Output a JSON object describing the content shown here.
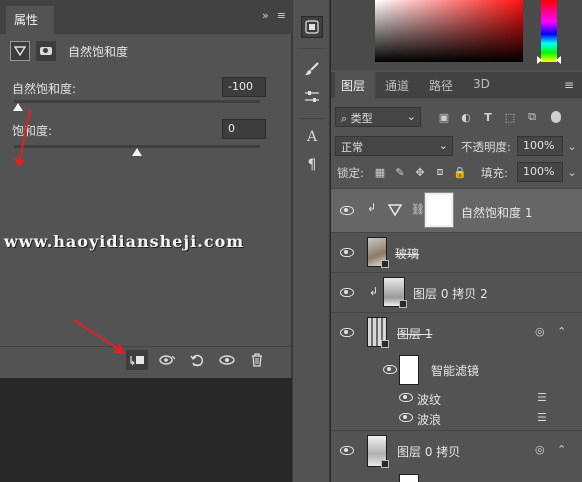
{
  "properties_panel": {
    "tab_label": "属性",
    "header_icons": [
      "»",
      "≡"
    ],
    "adjustment_title": "自然饱和度",
    "vibrance": {
      "label": "自然饱和度:",
      "value": "-100",
      "level": 0.0
    },
    "saturation": {
      "label": "饱和度:",
      "value": "0",
      "level": 0.5
    },
    "footer_buttons": [
      "clip-to-layer",
      "view-previous",
      "reset",
      "visibility",
      "delete"
    ]
  },
  "watermark": "www.haoyidiansheji.com",
  "layers_panel": {
    "tabs": [
      {
        "label": "图层",
        "active": true
      },
      {
        "label": "通道",
        "active": false
      },
      {
        "label": "路径",
        "active": false
      },
      {
        "label": "3D",
        "active": false
      }
    ],
    "filter_kind": "类型",
    "blend_mode": "正常",
    "opacity_label": "不透明度:",
    "opacity_value": "100%",
    "lock_label": "锁定:",
    "fill_label": "填充:",
    "fill_value": "100%",
    "layers": [
      {
        "name": "自然饱和度 1",
        "kind": "adjustment",
        "selected": true,
        "clipped": true
      },
      {
        "name": "玻璃",
        "kind": "smart-object",
        "selected": false
      },
      {
        "name": "图层 0 拷贝 2",
        "kind": "smart-object",
        "selected": false,
        "clipped": true
      },
      {
        "name": "图层 1",
        "kind": "smart-object",
        "selected": false
      },
      {
        "name": "智能滤镜",
        "kind": "smart-filter-mask",
        "selected": false
      },
      {
        "name": "波纹",
        "kind": "filter",
        "selected": false
      },
      {
        "name": "波浪",
        "kind": "filter",
        "selected": false
      },
      {
        "name": "图层 0 拷贝",
        "kind": "smart-object",
        "selected": false
      }
    ]
  },
  "colors": {
    "accent_arrow": "#e02020",
    "panel": "#535353",
    "selected_row": "#666666"
  }
}
